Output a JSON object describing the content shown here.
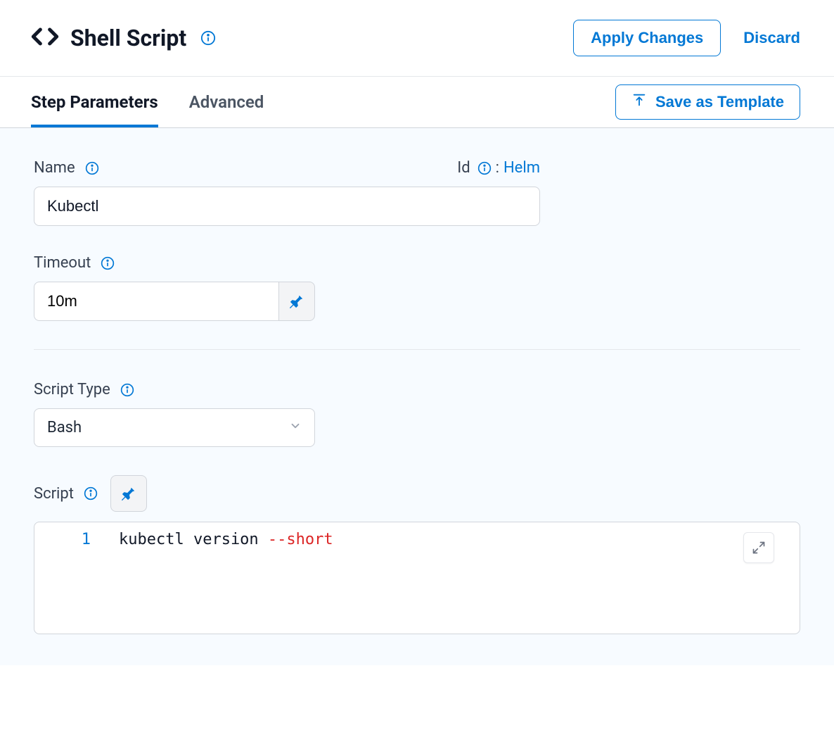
{
  "header": {
    "title": "Shell Script",
    "apply_label": "Apply Changes",
    "discard_label": "Discard"
  },
  "tabs": {
    "step_params": "Step Parameters",
    "advanced": "Advanced",
    "save_template": "Save as Template"
  },
  "form": {
    "name_label": "Name",
    "name_value": "Kubectl",
    "id_label": "Id",
    "id_value": "Helm",
    "timeout_label": "Timeout",
    "timeout_value": "10m",
    "script_type_label": "Script Type",
    "script_type_value": "Bash",
    "script_label": "Script",
    "script_line_number": "1",
    "script_code_cmd": "kubectl version ",
    "script_code_flag": "--short"
  }
}
